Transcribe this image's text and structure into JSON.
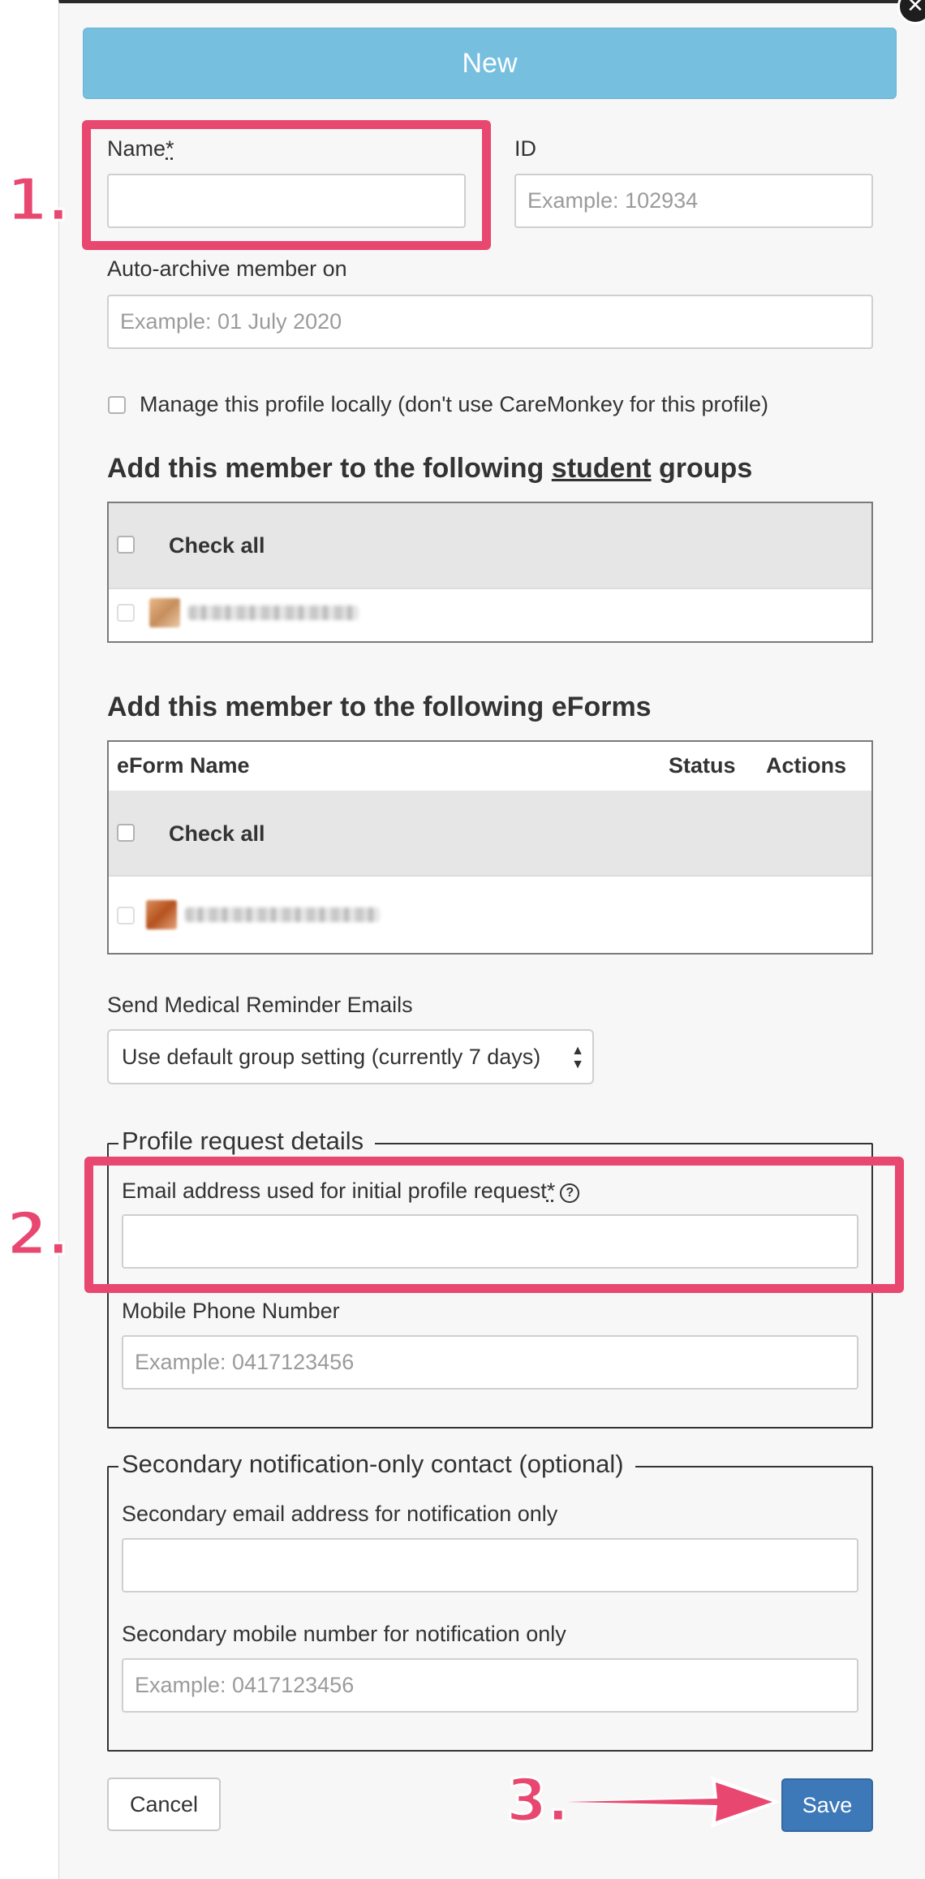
{
  "modal": {
    "close_symbol": "✕",
    "header_button": "New"
  },
  "fields": {
    "name_label": "Name",
    "name_required": "*",
    "name_value": "",
    "id_label": "ID",
    "id_placeholder": "Example: 102934",
    "archive_label": "Auto-archive member on",
    "archive_placeholder": "Example: 01 July 2020",
    "manage_locally_label": "Manage this profile locally (don't use CareMonkey for this profile)"
  },
  "student_groups": {
    "title_prefix": "Add this member to the following ",
    "title_link": "student",
    "title_suffix": " groups",
    "check_all": "Check all"
  },
  "eforms": {
    "title": "Add this member to the following eForms",
    "col_name": "eForm Name",
    "col_status": "Status",
    "col_actions": "Actions",
    "check_all": "Check all"
  },
  "reminder": {
    "label": "Send Medical Reminder Emails",
    "selected": "Use default group setting (currently 7 days)"
  },
  "profile_request": {
    "legend": "Profile request details",
    "email_label": "Email address used for initial profile request",
    "email_required": "*",
    "help_symbol": "?",
    "email_value": "",
    "mobile_label": "Mobile Phone Number",
    "mobile_placeholder": "Example: 0417123456"
  },
  "secondary": {
    "legend": "Secondary notification-only contact (optional)",
    "email_label": "Secondary email address for notification only",
    "email_value": "",
    "mobile_label": "Secondary mobile number for notification only",
    "mobile_placeholder": "Example: 0417123456"
  },
  "footer": {
    "cancel": "Cancel",
    "save": "Save"
  },
  "annotations": {
    "step1": "1.",
    "step2": "2.",
    "step3": "3.",
    "color": "#e8476f"
  }
}
